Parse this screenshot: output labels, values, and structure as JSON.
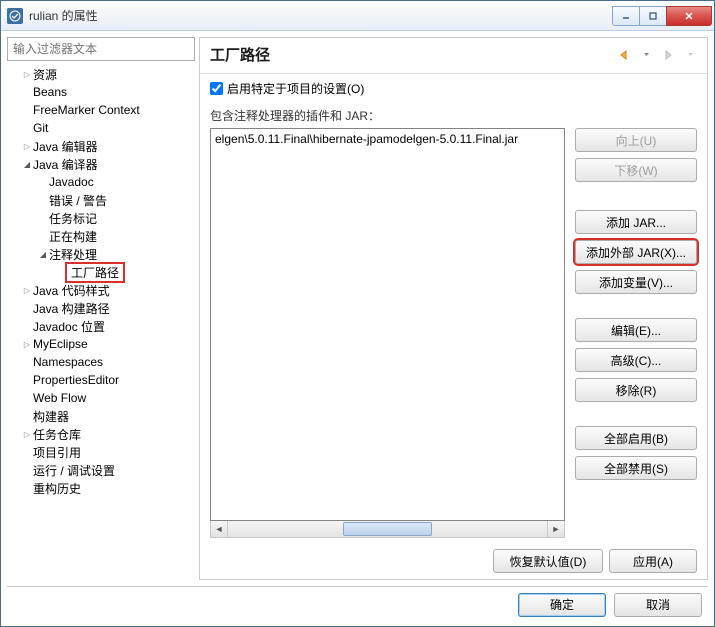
{
  "window": {
    "title": "rulian 的属性"
  },
  "filter": {
    "placeholder": "输入过滤器文本"
  },
  "tree": {
    "items": [
      {
        "label": "资源",
        "lvl": 1,
        "arrow": "collapsed"
      },
      {
        "label": "Beans",
        "lvl": 1,
        "arrow": "none"
      },
      {
        "label": "FreeMarker Context",
        "lvl": 1,
        "arrow": "none"
      },
      {
        "label": "Git",
        "lvl": 1,
        "arrow": "none"
      },
      {
        "label": "Java 编辑器",
        "lvl": 1,
        "arrow": "collapsed"
      },
      {
        "label": "Java 编译器",
        "lvl": 1,
        "arrow": "expanded"
      },
      {
        "label": "Javadoc",
        "lvl": 2,
        "arrow": "none"
      },
      {
        "label": "错误 / 警告",
        "lvl": 2,
        "arrow": "none"
      },
      {
        "label": "任务标记",
        "lvl": 2,
        "arrow": "none"
      },
      {
        "label": "正在构建",
        "lvl": 2,
        "arrow": "none"
      },
      {
        "label": "注释处理",
        "lvl": 2,
        "arrow": "expanded"
      },
      {
        "label": "工厂路径",
        "lvl": 3,
        "arrow": "none",
        "selected": true
      },
      {
        "label": "Java 代码样式",
        "lvl": 1,
        "arrow": "collapsed"
      },
      {
        "label": "Java 构建路径",
        "lvl": 1,
        "arrow": "none"
      },
      {
        "label": "Javadoc 位置",
        "lvl": 1,
        "arrow": "none"
      },
      {
        "label": "MyEclipse",
        "lvl": 1,
        "arrow": "collapsed"
      },
      {
        "label": "Namespaces",
        "lvl": 1,
        "arrow": "none"
      },
      {
        "label": "PropertiesEditor",
        "lvl": 1,
        "arrow": "none"
      },
      {
        "label": "Web Flow",
        "lvl": 1,
        "arrow": "none"
      },
      {
        "label": "构建器",
        "lvl": 1,
        "arrow": "none"
      },
      {
        "label": "任务仓库",
        "lvl": 1,
        "arrow": "collapsed"
      },
      {
        "label": "项目引用",
        "lvl": 1,
        "arrow": "none"
      },
      {
        "label": "运行 / 调试设置",
        "lvl": 1,
        "arrow": "none"
      },
      {
        "label": "重构历史",
        "lvl": 1,
        "arrow": "none"
      }
    ]
  },
  "page": {
    "heading": "工厂路径",
    "enable_label": "启用特定于项目的设置(O)",
    "enable_checked": true,
    "sub_label": "包含注释处理器的插件和 JAR：",
    "list_entry": "elgen\\5.0.11.Final\\hibernate-jpamodelgen-5.0.11.Final.jar",
    "buttons": {
      "up": "向上(U)",
      "down": "下移(W)",
      "add_jar": "添加 JAR...",
      "add_external_jar": "添加外部 JAR(X)...",
      "add_var": "添加变量(V)...",
      "edit": "编辑(E)...",
      "advanced": "高级(C)...",
      "remove": "移除(R)",
      "enable_all": "全部启用(B)",
      "disable_all": "全部禁用(S)",
      "restore": "恢复默认值(D)",
      "apply": "应用(A)"
    }
  },
  "footer": {
    "ok": "确定",
    "cancel": "取消"
  }
}
